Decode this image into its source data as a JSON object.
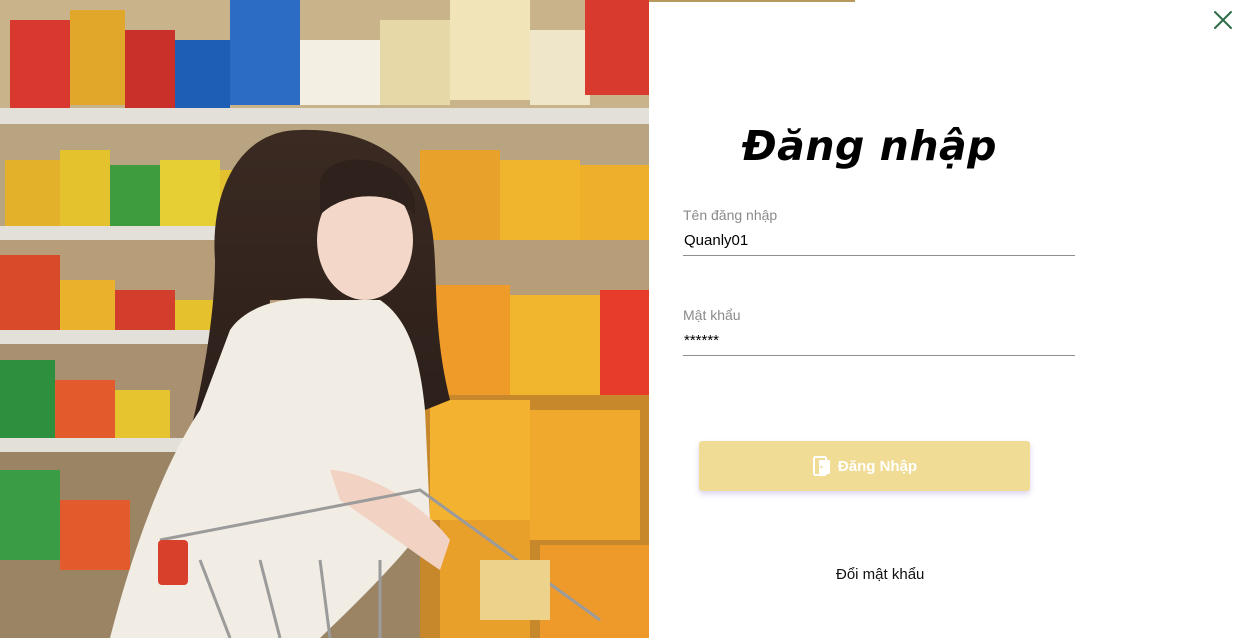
{
  "login_panel": {
    "title": "Đăng nhập",
    "username": {
      "label": "Tên đăng nhập",
      "value": "Quanly01"
    },
    "password": {
      "label": "Mật khẩu",
      "value": "******"
    },
    "login_button_label": "Đăng Nhập",
    "change_password_link": "Đổi mật khẩu"
  },
  "icons": {
    "close": "close-icon",
    "login": "login-door-icon"
  },
  "colors": {
    "login_button": "#f1dc96",
    "close_icon": "#2e6b4a",
    "field_label": "#8a8a8a"
  }
}
